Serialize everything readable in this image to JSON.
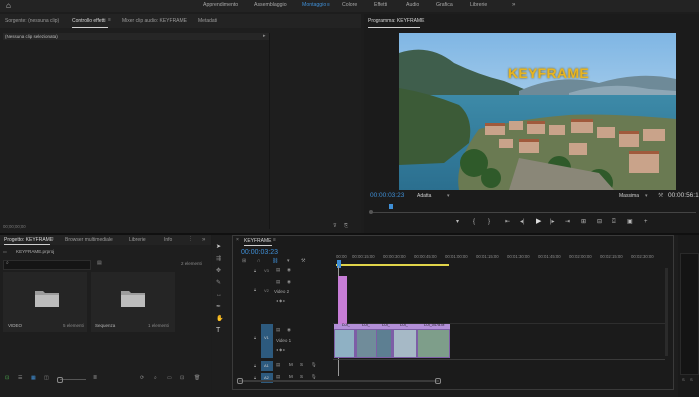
{
  "workspaces": {
    "home_icon": "home-icon",
    "items": [
      "Apprendimento",
      "Assemblaggio",
      "Montaggio",
      "Colore",
      "Effetti",
      "Audio",
      "Grafica",
      "Librerie"
    ],
    "active": "Montaggio",
    "more": "»"
  },
  "source_panel": {
    "tabs": [
      "Sorgente: (nessuna clip)",
      "Controllo effetti",
      "Mixer clip audio: KEYFRAME",
      "Metadati"
    ],
    "active_tab": "Controllo effetti",
    "empty_label": "(Nessuna clip selezionata)",
    "timecode": "00;00;00;00"
  },
  "program_monitor": {
    "title": "Programma: KEYFRAME",
    "overlay_text": "KEYFRAME",
    "timecode": "00:00:03:23",
    "fit": "Adatta",
    "quality": "Massima",
    "duration": "00:00:56:1",
    "accent": "#3f8fd6"
  },
  "project_panel": {
    "tabs": [
      "Progetto: KEYFRAME",
      "Browser multimediale",
      "Librerie",
      "Info"
    ],
    "active_tab": "Progetto: KEYFRAME",
    "file": "KEYFRAME.prproj",
    "count": "2 elementi",
    "items": [
      {
        "name": "VIDEO",
        "meta": "5 elementi"
      },
      {
        "name": "Sequenza",
        "meta": "1 elementi"
      }
    ]
  },
  "timeline": {
    "title": "KEYFRAME",
    "timecode": "00:00:03:23",
    "ruler": [
      "00:00",
      "00:00:15:00",
      "00:00:30:00",
      "00:00:45:00",
      "00:01:00:00",
      "00:01:15:00",
      "00:01:30:00",
      "00:01:45:00",
      "00:02:00:00",
      "00:02:15:00",
      "00:02:30:00"
    ],
    "tracks": [
      {
        "id": "V3",
        "name": ""
      },
      {
        "id": "V2",
        "name": "Video 2"
      },
      {
        "id": "V1",
        "name": "Video 1"
      },
      {
        "id": "A1",
        "name": ""
      },
      {
        "id": "A2",
        "name": ""
      }
    ],
    "clips": [
      "DJI_",
      "DJI_",
      "DJI_",
      "DJI_",
      "DJI_0478.M"
    ],
    "clip_color": "#b38fd8",
    "adjust_color": "#c77dd6"
  }
}
